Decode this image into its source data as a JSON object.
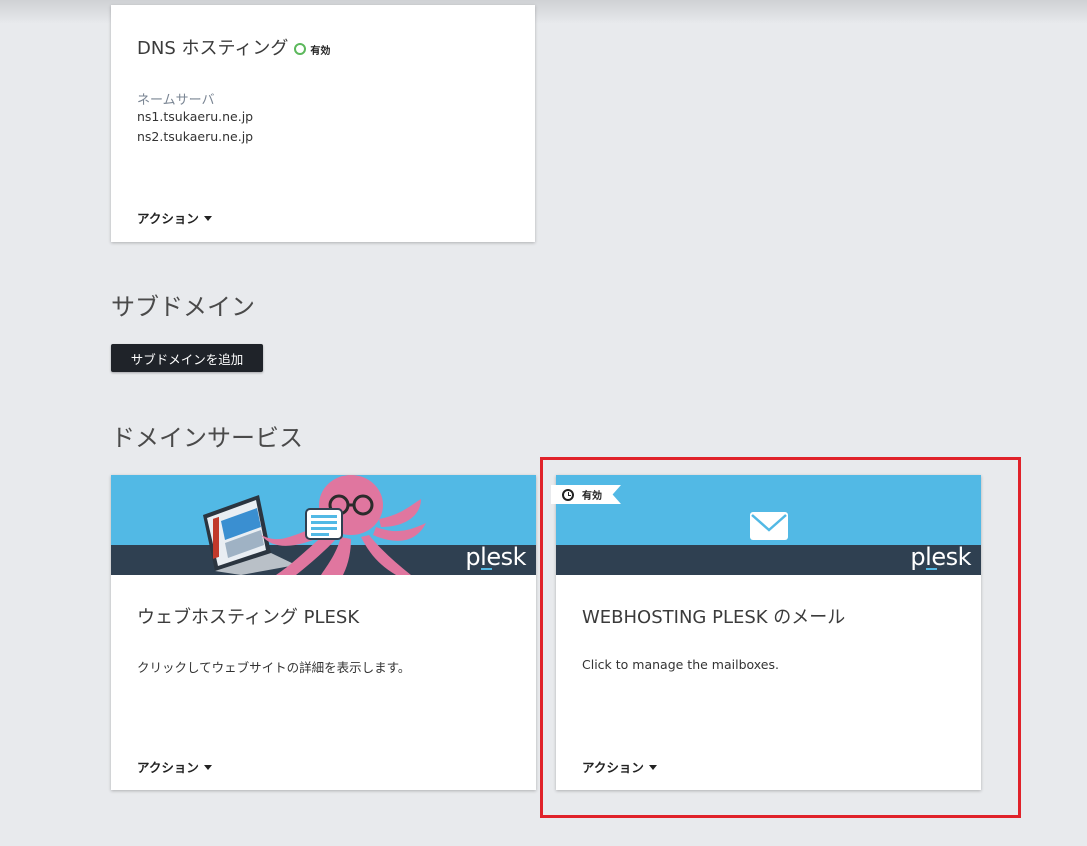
{
  "dns_card": {
    "title": "DNS ホスティング",
    "status": "有効",
    "nameserver_label": "ネームサーバ",
    "nameservers": [
      "ns1.tsukaeru.ne.jp",
      "ns2.tsukaeru.ne.jp"
    ],
    "action_label": "アクション"
  },
  "subdomain_section": {
    "title": "サブドメイン",
    "add_button_label": "サブドメインを追加"
  },
  "domain_services": {
    "title": "ドメインサービス",
    "cards": [
      {
        "title": "ウェブホスティング PLESK",
        "description": "クリックしてウェブサイトの詳細を表示します。",
        "action_label": "アクション",
        "logo_text": "plesk"
      },
      {
        "status": "有効",
        "title": "WEBHOSTING PLESK のメール",
        "description": "Click to manage the mailboxes.",
        "action_label": "アクション",
        "logo_text": "plesk"
      }
    ]
  },
  "icons": {
    "status": "status-ring-icon",
    "caret": "caret-down-icon",
    "clock": "clock-icon",
    "mail": "envelope-icon"
  },
  "colors": {
    "accent_blue": "#52b9e5",
    "banner_dark": "#2f4051",
    "status_green": "#5cb85c",
    "highlight_red": "#e0222a",
    "octopus_pink": "#e0769f"
  }
}
